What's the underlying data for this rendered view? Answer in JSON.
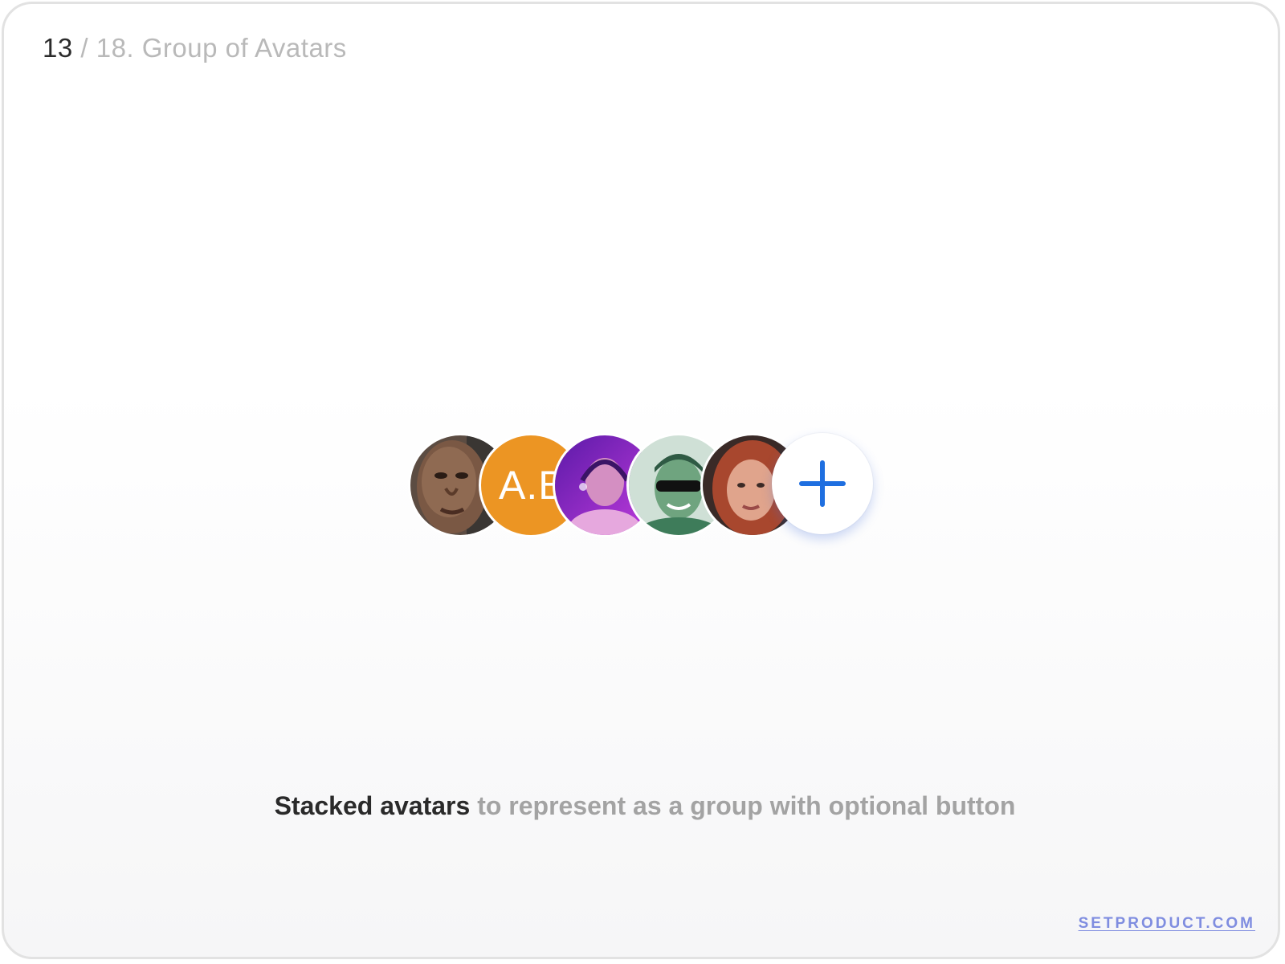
{
  "header": {
    "current": "13",
    "rest": " / 18. Group of Avatars"
  },
  "avatars": [
    {
      "type": "photo",
      "name": "avatar-photo-1",
      "palette": [
        "#6a5a4e",
        "#4b3527",
        "#8d6b55"
      ]
    },
    {
      "type": "initials",
      "name": "avatar-initials",
      "text": "A.B",
      "color": "#ec9523"
    },
    {
      "type": "photo",
      "name": "avatar-photo-2",
      "palette": [
        "#7b22c9",
        "#b33ad6",
        "#d8a2c8"
      ]
    },
    {
      "type": "photo",
      "name": "avatar-photo-3",
      "palette": [
        "#6fa88a",
        "#2e6b4a",
        "#c8d8cf"
      ]
    },
    {
      "type": "photo",
      "name": "avatar-photo-4",
      "palette": [
        "#3c2a26",
        "#b5553a",
        "#e2a58d"
      ]
    }
  ],
  "add_button": {
    "icon": "plus-icon",
    "color": "#1f6fe0"
  },
  "caption": {
    "strong": "Stacked avatars",
    "rest": " to represent as a group with optional button"
  },
  "brand": {
    "text": "SETPRODUCT.COM",
    "color": "#7f8de0"
  }
}
